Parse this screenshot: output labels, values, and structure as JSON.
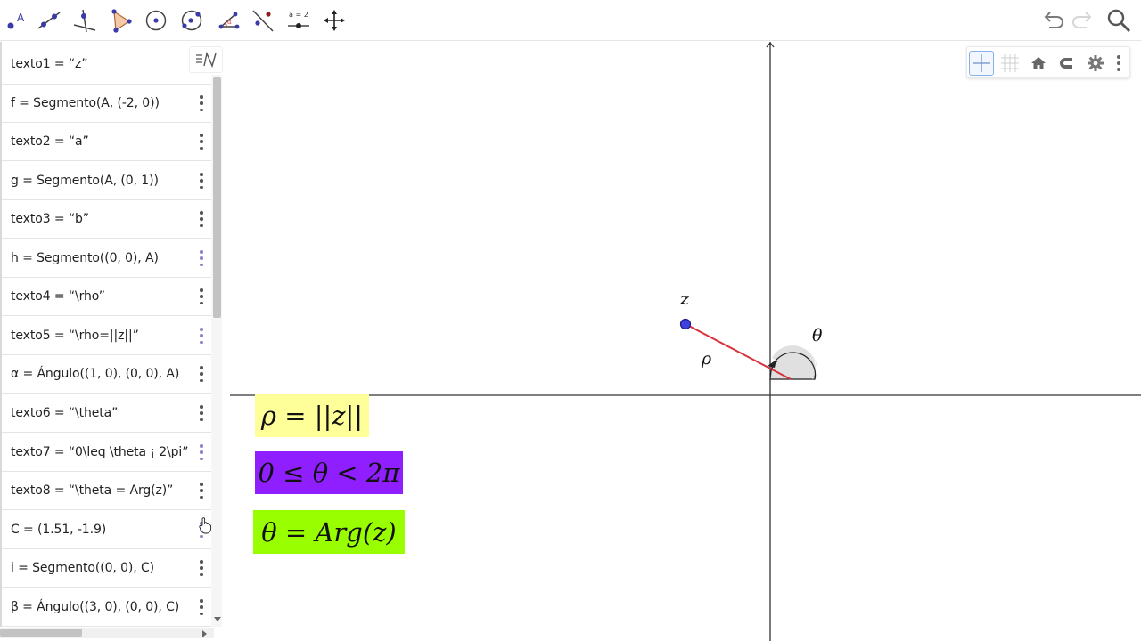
{
  "toolbar": {
    "tools": [
      "point-tool",
      "line-tool",
      "perpendicular-line-tool",
      "polygon-tool",
      "circle-center-tool",
      "circle-three-points-tool",
      "angle-tool",
      "reflect-tool",
      "slider-tool",
      "move-graphics-view-tool"
    ],
    "point_label": "A",
    "slider_label": "a = 2",
    "actions": [
      "undo-icon",
      "redo-icon",
      "search-icon",
      "menu-icon"
    ]
  },
  "algebra": {
    "items": [
      {
        "text": "texto1 = “z”",
        "dots": false
      },
      {
        "text": "f = Segmento(A, (-2, 0))",
        "dots": true,
        "light": false
      },
      {
        "text": "texto2 = “a”",
        "dots": true,
        "light": false
      },
      {
        "text": "g = Segmento(A, (0, 1))",
        "dots": true,
        "light": false
      },
      {
        "text": "texto3 = “b”",
        "dots": true,
        "light": false
      },
      {
        "text": "h = Segmento((0, 0), A)",
        "dots": true,
        "light": true
      },
      {
        "text": "texto4 = “\\rho”",
        "dots": true,
        "light": false
      },
      {
        "text": "texto5 = “\\rho=||z||”",
        "dots": true,
        "light": true
      },
      {
        "text": "α = Ángulo((1, 0), (0, 0), A)",
        "dots": true,
        "light": false
      },
      {
        "text": "texto6 = “\\theta”",
        "dots": true,
        "light": false
      },
      {
        "text": "texto7 = “0\\leq \\theta ¡ 2\\pi”",
        "dots": true,
        "light": true
      },
      {
        "text": "texto8 = “\\theta = Arg(z)”",
        "dots": true,
        "light": false
      },
      {
        "text": "C = (1.51, -1.9)",
        "dots": true,
        "light": true
      },
      {
        "text": "i = Segmento((0, 0), C)",
        "dots": true,
        "light": false
      },
      {
        "text": "β = Ángulo((3, 0), (0, 0), C)",
        "dots": true,
        "light": false
      }
    ]
  },
  "graphics": {
    "labels": {
      "z": "z",
      "rho": "ρ",
      "theta": "θ"
    },
    "boxes": [
      {
        "id": "rho-norm",
        "text": "ρ = ||z||",
        "color": "#ffff99"
      },
      {
        "id": "theta-range",
        "text": "0 ≤ θ < 2π",
        "color": "#8f1fff"
      },
      {
        "id": "theta-arg",
        "text": "θ = Arg(z)",
        "color": "#99ff00"
      }
    ],
    "colors": {
      "point": "#4040e0",
      "segment": "#d8323c",
      "axis": "#333333",
      "angle_fill": "#e0e0e0"
    }
  }
}
